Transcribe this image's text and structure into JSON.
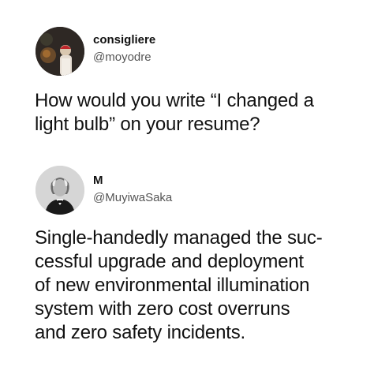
{
  "tweets": [
    {
      "display_name": "consigliere",
      "handle": "@moyodre",
      "avatar_icon": "person-red-cap-avatar",
      "lines": [
        "How would you write “I changed a",
        "light bulb” on your resume?"
      ]
    },
    {
      "display_name": "M",
      "handle": "@MuyiwaSaka",
      "avatar_icon": "vintage-portrait-avatar",
      "lines": [
        "Single-handedly managed the suc-",
        "cessful upgrade and deployment",
        "of new environmental illumination",
        "system with zero cost overruns",
        "and zero safety incidents."
      ]
    }
  ]
}
